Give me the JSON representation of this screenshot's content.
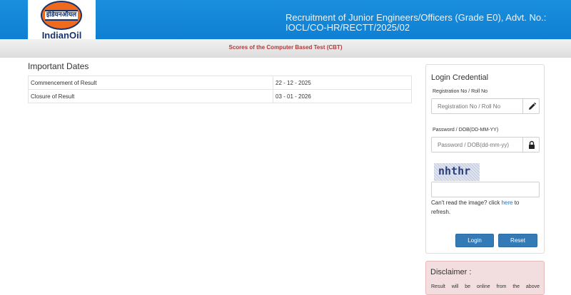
{
  "header": {
    "logo_hindi": "इंडियनऑयल",
    "logo_text": "IndianOil",
    "title_line1": "Recruitment of Junior Engineers/Officers (Grade E0), Advt. No.:",
    "title_line2": "IOCL/CO-HR/RECTT/2025/02",
    "color": "#1a8fdc"
  },
  "subheader": {
    "text": "Scores of the Computer Based Test (CBT)",
    "color": "#b23a3a"
  },
  "important_dates": {
    "heading": "Important Dates",
    "rows": [
      {
        "label": "Commencement of Result",
        "value": "22 - 12 - 2025"
      },
      {
        "label": "Closure of Result",
        "value": "03 - 01 - 2026"
      }
    ]
  },
  "login": {
    "title": "Login Credential",
    "reg_label": "Registration No / Roll No",
    "reg_placeholder": "Registration No / Roll No",
    "reg_icon": "pencil-icon",
    "password_label": "Password / DOB(DD-MM-YY)",
    "password_placeholder": "Password / DOB(dd-mm-yy)",
    "password_icon": "lock-icon",
    "captcha_text": "nhthr",
    "captcha_value": "",
    "refresh_prefix": "Can't read the image? click ",
    "refresh_link": "here",
    "refresh_suffix": " to refresh.",
    "login_label": "Login",
    "reset_label": "Reset",
    "button_color": "#337ab7"
  },
  "disclaimer": {
    "title": "Disclaimer :",
    "text": "Result will be online from the above"
  }
}
